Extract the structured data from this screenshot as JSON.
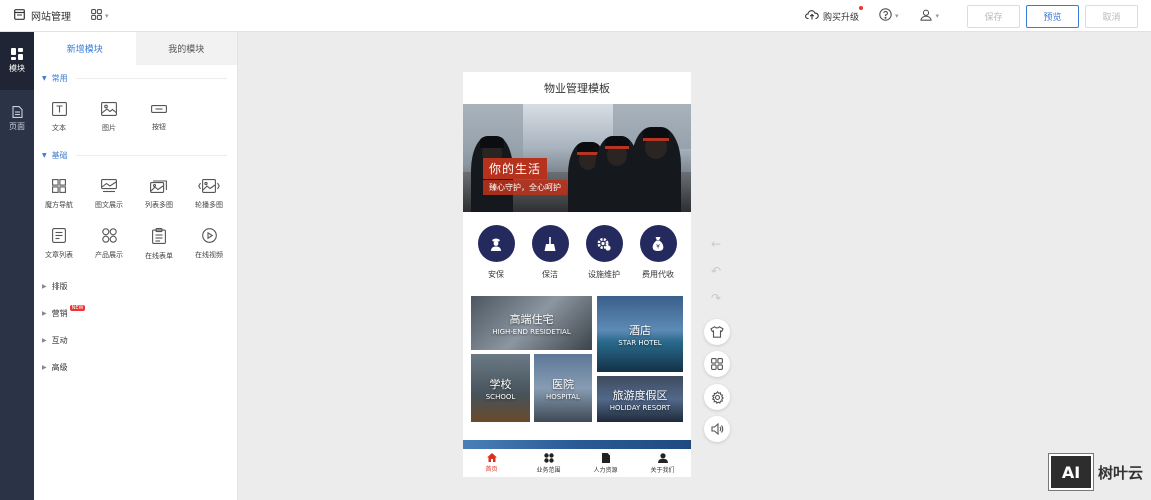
{
  "topbar": {
    "title": "网站管理",
    "buy_label": "购买升级",
    "save_label": "保存",
    "preview_label": "预览",
    "cancel_label": "取消"
  },
  "leftnav": {
    "items": [
      {
        "label": "模块",
        "icon": "modules-icon"
      },
      {
        "label": "页面",
        "icon": "page-icon"
      }
    ]
  },
  "panel": {
    "tabs": [
      "新增模块",
      "我的模块"
    ],
    "sections": {
      "common": {
        "title": "常用",
        "items": [
          {
            "label": "文本",
            "icon": "text-icon"
          },
          {
            "label": "图片",
            "icon": "image-icon"
          },
          {
            "label": "按钮",
            "icon": "button-icon"
          }
        ]
      },
      "basic": {
        "title": "基础",
        "items": [
          {
            "label": "魔方导航",
            "icon": "cube-nav-icon"
          },
          {
            "label": "图文展示",
            "icon": "image-text-icon"
          },
          {
            "label": "列表多图",
            "icon": "list-images-icon"
          },
          {
            "label": "轮播多图",
            "icon": "carousel-icon"
          },
          {
            "label": "文章列表",
            "icon": "article-list-icon"
          },
          {
            "label": "产品展示",
            "icon": "product-icon"
          },
          {
            "label": "在线表单",
            "icon": "form-icon"
          },
          {
            "label": "在线视频",
            "icon": "video-icon"
          }
        ]
      },
      "collapsed": [
        {
          "title": "排版"
        },
        {
          "title": "营销",
          "badge": "NEW"
        },
        {
          "title": "互动"
        },
        {
          "title": "高级"
        }
      ]
    }
  },
  "phone": {
    "title": "物业管理模板",
    "banner": {
      "slogan_main": "你的生活",
      "slogan_sub": "臻心守护，全心呵护"
    },
    "services": [
      {
        "label": "安保",
        "icon": "security-guard-icon"
      },
      {
        "label": "保洁",
        "icon": "broom-icon"
      },
      {
        "label": "设施维护",
        "icon": "gear-maintenance-icon"
      },
      {
        "label": "费用代收",
        "icon": "money-bag-icon"
      }
    ],
    "tiles": [
      {
        "cn": "高端住宅",
        "en": "HIGH-END RESIDETIAL"
      },
      {
        "cn": "酒店",
        "en": "STAR HOTEL"
      },
      {
        "cn": "学校",
        "en": "SCHOOL"
      },
      {
        "cn": "医院",
        "en": "HOSPITAL"
      },
      {
        "cn": "旅游度假区",
        "en": "HOLIDAY RESORT"
      }
    ],
    "tabbar": [
      {
        "label": "首页",
        "icon": "home-icon"
      },
      {
        "label": "业务范围",
        "icon": "grid-icon"
      },
      {
        "label": "人力资源",
        "icon": "document-icon"
      },
      {
        "label": "关于我们",
        "icon": "person-icon"
      }
    ]
  },
  "watermark": {
    "logo": "AI",
    "text": "树叶云"
  },
  "colors": {
    "accent": "#3a7bd5",
    "nav_bg": "#2b3346",
    "service_circle": "#242a5e",
    "brand_red": "#d9321f"
  }
}
